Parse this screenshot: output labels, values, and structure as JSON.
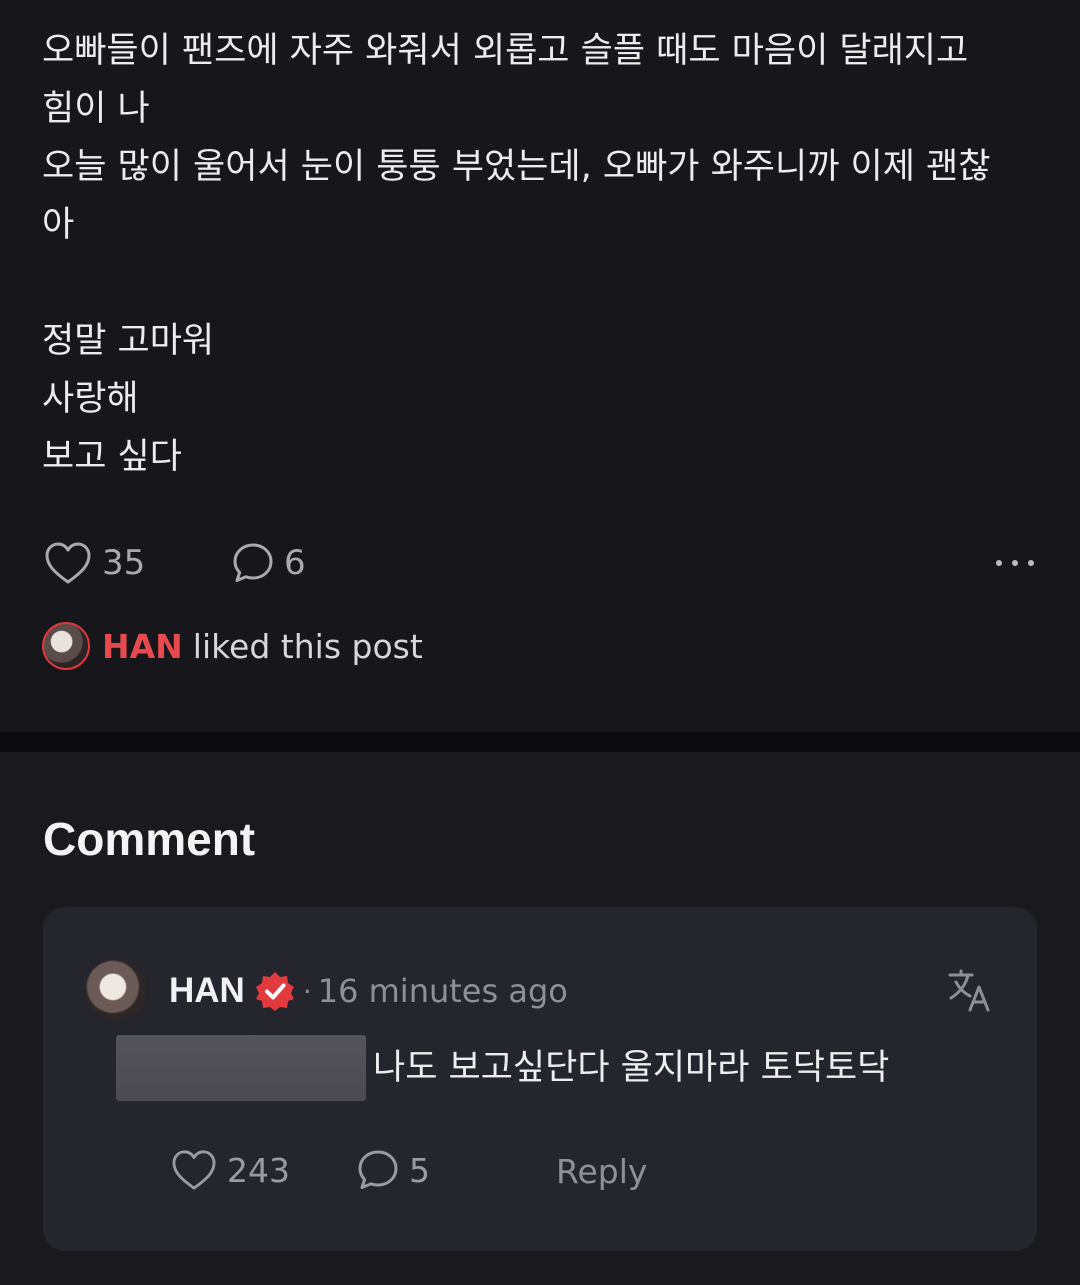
{
  "post": {
    "lines": [
      "오빠들이 팬즈에 자주 와줘서 외롭고 슬플 때도 마음이 달래지고",
      "힘이 나",
      "오늘 많이 울어서 눈이 퉁퉁 부었는데, 오빠가 와주니까 이제 괜찮",
      "아",
      "",
      "정말 고마워",
      "사랑해",
      "보고 싶다"
    ],
    "likes": "35",
    "comments": "6",
    "liked_by": {
      "name": "HAN",
      "suffix": "liked this post"
    }
  },
  "comments_section": {
    "title": "Comment",
    "items": [
      {
        "author": "HAN",
        "verified": true,
        "time": "16 minutes ago",
        "text": "나도 보고싶단다 울지마라 토닥토닥",
        "likes": "243",
        "replies": "5",
        "reply_label": "Reply"
      }
    ]
  },
  "colors": {
    "background": "#17171b",
    "card": "#25252d",
    "accent": "#e64a4f"
  },
  "icons": [
    "heart-icon",
    "comment-icon",
    "more-icon",
    "verified-badge-icon",
    "translate-icon"
  ]
}
